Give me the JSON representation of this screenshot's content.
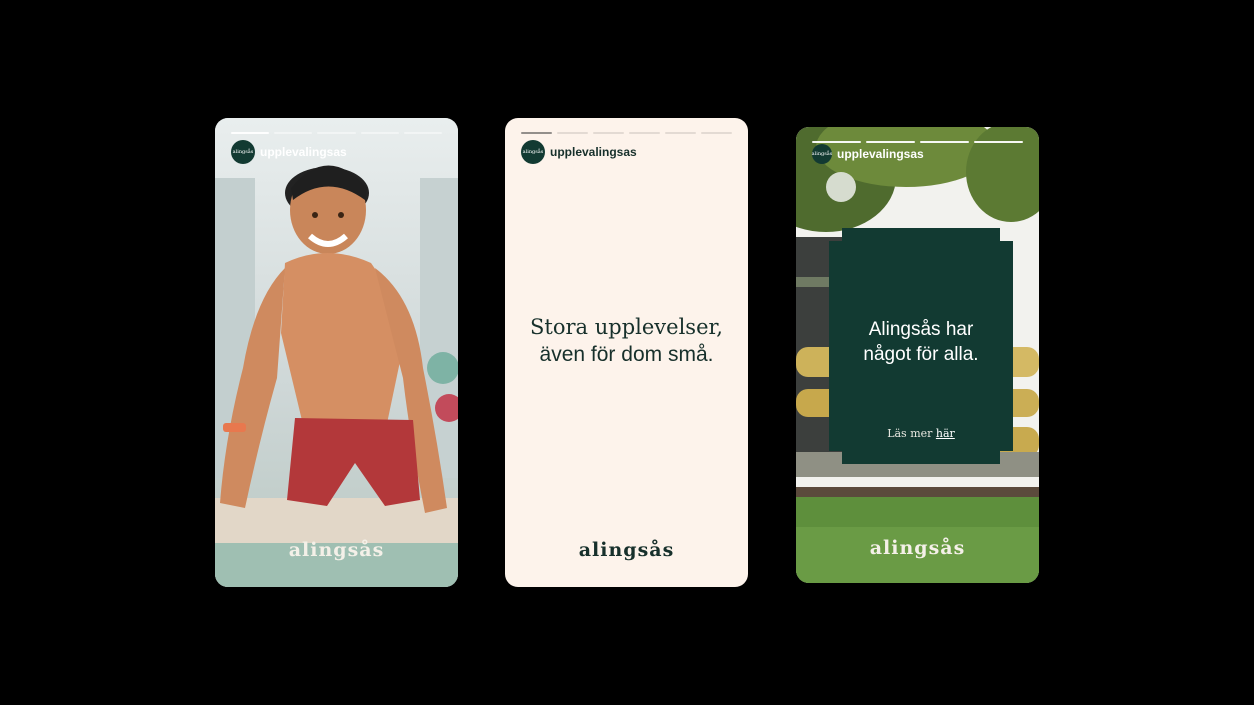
{
  "stories": [
    {
      "username": "upplevalingsas",
      "avatar_text": "alingsås",
      "brand": "alingsås",
      "image": "boy-in-swimming-pool"
    },
    {
      "username": "upplevalingsas",
      "avatar_text": "alingsås",
      "headline_line1": "Stora upplevelser,",
      "headline_line2": "även för dom små.",
      "brand": "alingsås"
    },
    {
      "username": "upplevalingsas",
      "avatar_text": "alingsås",
      "card_title_line1": "Alingsås har",
      "card_title_line2": "något för alla.",
      "link_prefix": "Läs mer ",
      "link_text": "här",
      "brand": "alingsås",
      "image": "park-with-yellow-waterslides"
    }
  ],
  "colors": {
    "background": "#000000",
    "brand_green": "#123a32",
    "cream": "#fdf3eb"
  }
}
